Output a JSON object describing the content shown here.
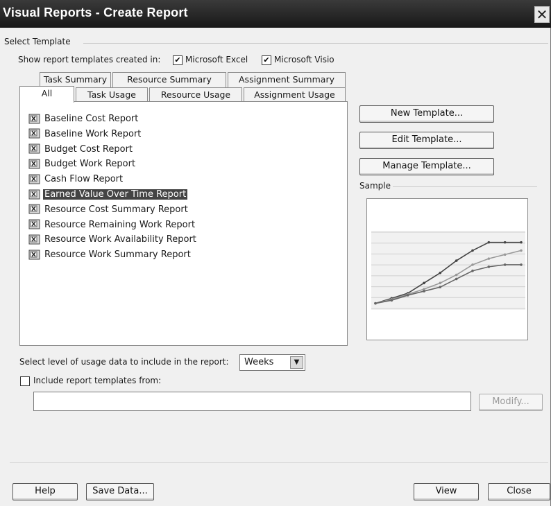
{
  "window": {
    "title": "Visual Reports - Create Report",
    "close_glyph": "✕"
  },
  "select_template": {
    "group_label": "Select Template",
    "show_created_in_label": "Show report templates created in:",
    "excel": {
      "label": "Microsoft Excel",
      "checked": true
    },
    "visio": {
      "label": "Microsoft Visio",
      "checked": true
    },
    "tabs_row1": [
      "Task Summary",
      "Resource Summary",
      "Assignment Summary"
    ],
    "tabs_row2": [
      "All",
      "Task Usage",
      "Resource Usage",
      "Assignment Usage"
    ],
    "active_tab": "All",
    "reports": [
      {
        "label": "Baseline Cost Report",
        "type": "excel"
      },
      {
        "label": "Baseline Work Report",
        "type": "excel"
      },
      {
        "label": "Budget Cost Report",
        "type": "excel"
      },
      {
        "label": "Budget Work Report",
        "type": "excel"
      },
      {
        "label": "Cash Flow Report",
        "type": "excel"
      },
      {
        "label": "Earned Value Over Time Report",
        "type": "excel",
        "selected": true
      },
      {
        "label": "Resource Cost Summary Report",
        "type": "excel"
      },
      {
        "label": "Resource Remaining Work Report",
        "type": "excel"
      },
      {
        "label": "Resource Work Availability Report",
        "type": "excel"
      },
      {
        "label": "Resource Work Summary Report",
        "type": "excel"
      }
    ]
  },
  "buttons": {
    "new_template": "New Template...",
    "edit_template": "Edit Template...",
    "manage_template": "Manage Template...",
    "modify": "Modify...",
    "help": "Help",
    "save_data": "Save Data...",
    "view": "View",
    "close": "Close"
  },
  "sample": {
    "label": "Sample",
    "chart_data": {
      "type": "line",
      "x": [
        1,
        2,
        3,
        4,
        5,
        6,
        7,
        8,
        9,
        10
      ],
      "series": [
        {
          "values": [
            0,
            5,
            10,
            20,
            30,
            42,
            52,
            60,
            60,
            60
          ],
          "color": "#444444"
        },
        {
          "values": [
            0,
            4,
            9,
            14,
            20,
            28,
            38,
            44,
            48,
            52
          ],
          "color": "#999999"
        },
        {
          "values": [
            0,
            3,
            8,
            12,
            16,
            24,
            32,
            36,
            38,
            38
          ],
          "color": "#666666"
        }
      ],
      "ylim": [
        -5,
        70
      ],
      "grid": true
    }
  },
  "usage_level": {
    "label": "Select level of usage data to include in the report:",
    "value": "Weeks"
  },
  "include_templates": {
    "label": "Include report templates from:",
    "checked": false,
    "path_value": ""
  },
  "colors": {
    "titlebar": "#222222",
    "selection": "#444444",
    "dialog_bg": "#f0f0f0"
  }
}
